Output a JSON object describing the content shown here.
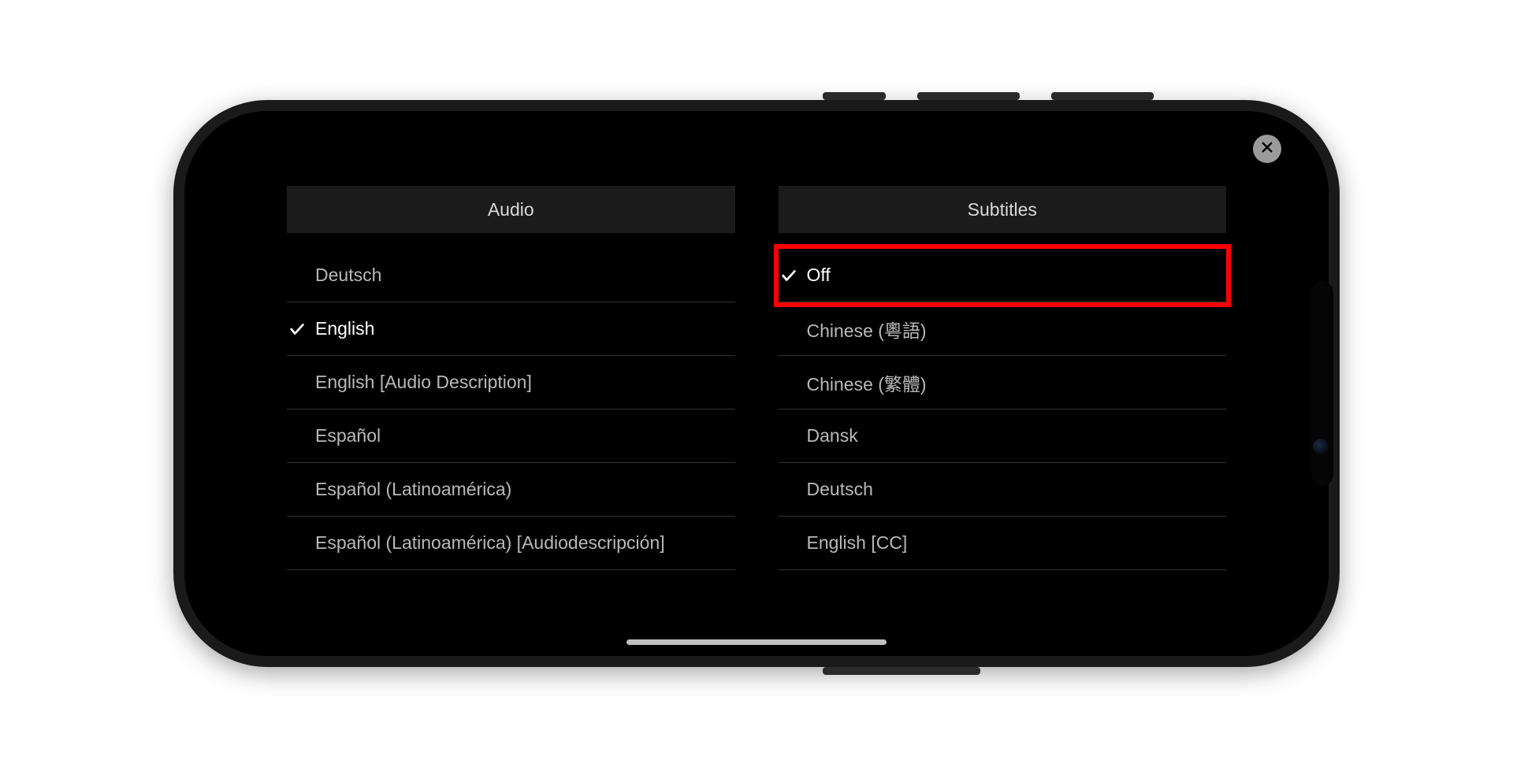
{
  "headers": {
    "audio": "Audio",
    "subtitles": "Subtitles"
  },
  "audio_options": [
    {
      "label": "Deutsch",
      "selected": false
    },
    {
      "label": "English",
      "selected": true
    },
    {
      "label": "English [Audio Description]",
      "selected": false
    },
    {
      "label": "Español",
      "selected": false
    },
    {
      "label": "Español (Latinoamérica)",
      "selected": false
    },
    {
      "label": "Español (Latinoamérica) [Audiodescripción]",
      "selected": false
    }
  ],
  "subtitle_options": [
    {
      "label": "Off",
      "selected": true
    },
    {
      "label": "Chinese (粵語)",
      "selected": false
    },
    {
      "label": "Chinese (繁體)",
      "selected": false
    },
    {
      "label": "Dansk",
      "selected": false
    },
    {
      "label": "Deutsch",
      "selected": false
    },
    {
      "label": "English [CC]",
      "selected": false
    }
  ],
  "highlighted_subtitle_index": 0
}
